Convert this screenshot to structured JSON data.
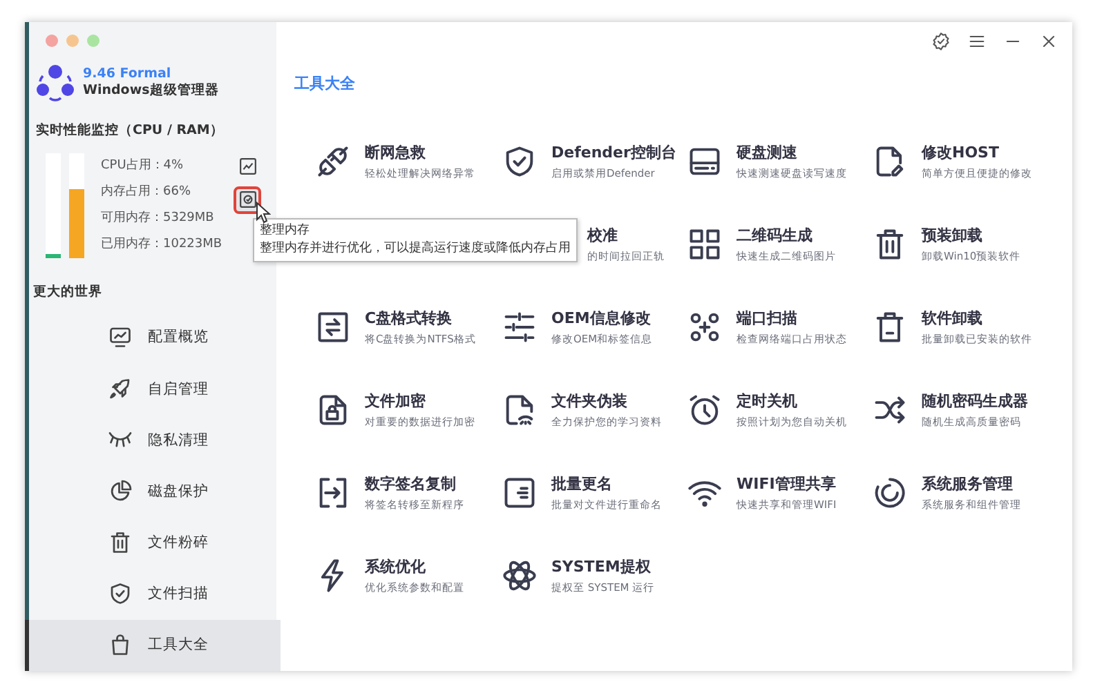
{
  "app": {
    "version": "9.46 Formal",
    "name": "Windows超级管理器"
  },
  "monitor": {
    "title": "实时性能监控（CPU / RAM）",
    "bars": [
      {
        "level": 0.04,
        "color": "#2bb673"
      },
      {
        "level": 0.66,
        "color": "#f5a623"
      }
    ],
    "stats": [
      "CPU占用：4%",
      "内存占用：66%",
      "可用内存：5329MB",
      "已用内存：10223MB"
    ],
    "actions": [
      {
        "hovered": false
      },
      {
        "hovered": true
      }
    ]
  },
  "section_title": "更大的世界",
  "nav": [
    {
      "label": "配置概览",
      "selected": false
    },
    {
      "label": "自启管理",
      "selected": false
    },
    {
      "label": "隐私清理",
      "selected": false
    },
    {
      "label": "磁盘保护",
      "selected": false
    },
    {
      "label": "文件粉碎",
      "selected": false
    },
    {
      "label": "文件扫描",
      "selected": false
    },
    {
      "label": "工具大全",
      "selected": true
    }
  ],
  "page_title": "工具大全",
  "tools": [
    {
      "kind": "tool",
      "title": "断网急救",
      "description": "轻松处理解决网络异常"
    },
    {
      "kind": "tool",
      "title": "Defender控制台",
      "description": "启用或禁用Defender"
    },
    {
      "kind": "tool",
      "title": "硬盘测速",
      "description": "快速测速硬盘读写速度"
    },
    {
      "kind": "tool",
      "title": "修改HOST",
      "description": "简单方便且便捷的修改"
    },
    {
      "kind": "covered"
    },
    {
      "kind": "partial",
      "title": "校准",
      "description": "的时间拉回正轨"
    },
    {
      "kind": "tool",
      "title": "二维码生成",
      "description": "快速生成二维码图片"
    },
    {
      "kind": "tool",
      "title": "预装卸载",
      "description": "卸载Win10预装软件"
    },
    {
      "kind": "tool",
      "title": "C盘格式转换",
      "description": "将C盘转换为NTFS格式"
    },
    {
      "kind": "tool",
      "title": "OEM信息修改",
      "description": "修改OEM和标签信息"
    },
    {
      "kind": "tool",
      "title": "端口扫描",
      "description": "检查网络端口占用状态"
    },
    {
      "kind": "tool",
      "title": "软件卸载",
      "description": "批量卸载已安装的软件"
    },
    {
      "kind": "tool",
      "title": "文件加密",
      "description": "对重要的数据进行加密"
    },
    {
      "kind": "tool",
      "title": "文件夹伪装",
      "description": "全力保护您的学习资料"
    },
    {
      "kind": "tool",
      "title": "定时关机",
      "description": "按照计划为您自动关机"
    },
    {
      "kind": "tool",
      "title": "随机密码生成器",
      "description": "随机生成高质量密码"
    },
    {
      "kind": "tool",
      "title": "数字签名复制",
      "description": "将签名转移至新程序"
    },
    {
      "kind": "tool",
      "title": "批量更名",
      "description": "批量对文件进行重命名"
    },
    {
      "kind": "tool",
      "title": "WIFI管理共享",
      "description": "快速共享和管理WIFI"
    },
    {
      "kind": "tool",
      "title": "系统服务管理",
      "description": "系统服务和组件管理"
    },
    {
      "kind": "tool",
      "title": "系统优化",
      "description": "优化系统参数和配置"
    },
    {
      "kind": "tool",
      "title": "SYSTEM提权",
      "description": "提权至 SYSTEM 运行"
    }
  ],
  "tooltip": {
    "title": "整理内存",
    "text": "整理内存并进行优化，可以提高运行速度或降低内存占用"
  }
}
